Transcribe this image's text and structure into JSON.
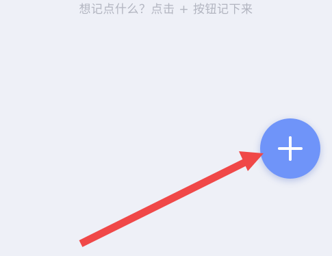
{
  "empty_state": {
    "hint_text": "想记点什么？点击 + 按钮记下来"
  },
  "fab": {
    "icon": "plus-icon",
    "color": "#6f94f9"
  },
  "annotation": {
    "icon": "red-arrow-icon",
    "color": "#f04848"
  }
}
